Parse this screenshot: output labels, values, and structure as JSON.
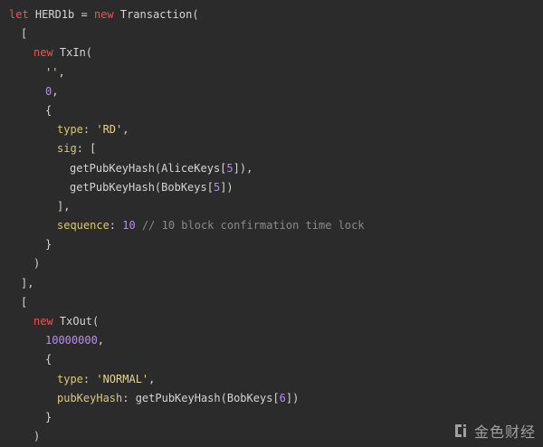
{
  "code": {
    "l01": {
      "a": "let",
      "b": " HERD1b = ",
      "c": "new",
      "d": " Transaction("
    },
    "l02": {
      "a": "["
    },
    "l03": {
      "a": "new",
      "b": " TxIn("
    },
    "l04": {
      "a": "''",
      "b": ","
    },
    "l05": {
      "a": "0",
      "b": ","
    },
    "l06": {
      "a": "{"
    },
    "l07": {
      "a": "type",
      "b": ": ",
      "c": "'RD'",
      "d": ","
    },
    "l08": {
      "a": "sig",
      "b": ": ["
    },
    "l09": {
      "a": "getPubKeyHash(AliceKeys[",
      "b": "5",
      "c": "]),"
    },
    "l10": {
      "a": "getPubKeyHash(BobKeys[",
      "b": "5",
      "c": "])"
    },
    "l11": {
      "a": "],"
    },
    "l12": {
      "a": "sequence",
      "b": ": ",
      "c": "10",
      "d": " // 10 block confirmation time lock"
    },
    "l13": {
      "a": "}"
    },
    "l14": {
      "a": ")"
    },
    "l15": {
      "a": "],"
    },
    "l16": {
      "a": "["
    },
    "l17": {
      "a": "new",
      "b": " TxOut("
    },
    "l18": {
      "a": "10000000",
      "b": ","
    },
    "l19": {
      "a": "{"
    },
    "l20": {
      "a": "type",
      "b": ": ",
      "c": "'NORMAL'",
      "d": ","
    },
    "l21": {
      "a": "pubKeyHash",
      "b": ": getPubKeyHash(BobKeys[",
      "c": "6",
      "d": "])"
    },
    "l22": {
      "a": "}"
    },
    "l23": {
      "a": ")"
    }
  },
  "watermark": {
    "logo_icon": "jinse-logo-icon",
    "text": "金色财经"
  },
  "colors": {
    "background": "#2b2b2b",
    "keyword": "#f0524f",
    "property": "#d8c874",
    "string": "#e8d389",
    "number": "#b98cf2",
    "comment": "#8a8a8a",
    "text": "#d4d4d4"
  }
}
